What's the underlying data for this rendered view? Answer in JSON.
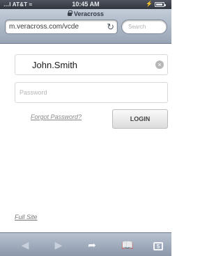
{
  "status_bar": {
    "carrier": "AT&T",
    "time": "10:45 AM"
  },
  "browser": {
    "page_title": "Veracross",
    "url": "m.veracross.com/vcde",
    "search_placeholder": "Search"
  },
  "login_form": {
    "username_value": "John.Smith",
    "password_placeholder": "Password",
    "forgot_password_label": "Forgot Password?",
    "login_label": "LOGIN"
  },
  "footer": {
    "full_site_label": "Full Site"
  },
  "toolbar": {
    "icons": [
      "back-icon",
      "forward-icon",
      "share-icon",
      "bookmarks-icon",
      "tabs-icon"
    ],
    "tabs_count": "5"
  },
  "colors": {
    "chrome_blue": "#98a4b5",
    "status_bar": "#30343d"
  }
}
